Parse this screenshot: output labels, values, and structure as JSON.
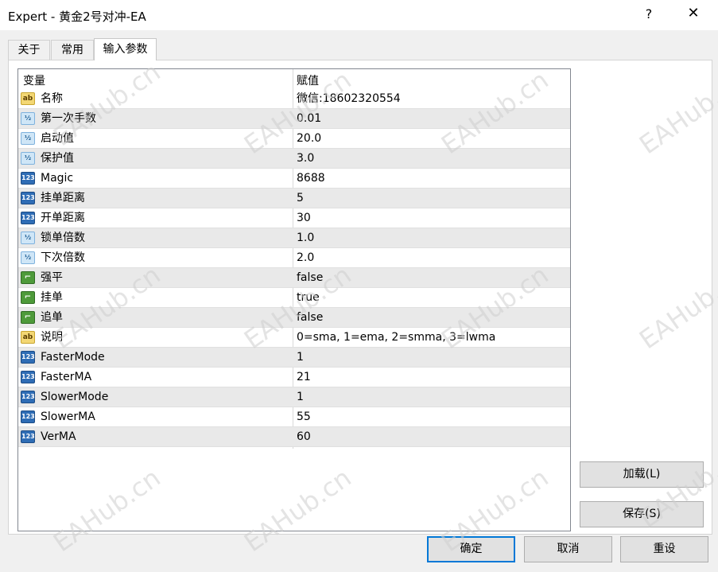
{
  "window": {
    "title": "Expert - 黄金2号对冲-EA",
    "help_label": "?",
    "close_label": "✕"
  },
  "tabs": [
    {
      "label": "关于"
    },
    {
      "label": "常用"
    },
    {
      "label": "输入参数"
    }
  ],
  "grid": {
    "headers": {
      "variable": "变量",
      "value": "赋值"
    },
    "rows": [
      {
        "icon": "ab",
        "name": "名称",
        "value": "微信:18602320554"
      },
      {
        "icon": "dec",
        "name": "第一次手数",
        "value": "0.01"
      },
      {
        "icon": "dec",
        "name": "启动值",
        "value": "20.0"
      },
      {
        "icon": "dec",
        "name": "保护值",
        "value": "3.0"
      },
      {
        "icon": "int",
        "name": "Magic",
        "value": "8688"
      },
      {
        "icon": "int",
        "name": "挂单距离",
        "value": "5"
      },
      {
        "icon": "int",
        "name": "开单距离",
        "value": "30"
      },
      {
        "icon": "dec",
        "name": "锁单倍数",
        "value": "1.0"
      },
      {
        "icon": "dec",
        "name": "下次倍数",
        "value": "2.0"
      },
      {
        "icon": "bool",
        "name": "强平",
        "value": "false"
      },
      {
        "icon": "bool",
        "name": "挂单",
        "value": "true"
      },
      {
        "icon": "bool",
        "name": "追单",
        "value": "false"
      },
      {
        "icon": "ab",
        "name": "说明",
        "value": "0=sma, 1=ema, 2=smma, 3=lwma"
      },
      {
        "icon": "int",
        "name": "FasterMode",
        "value": "1"
      },
      {
        "icon": "int",
        "name": "FasterMA",
        "value": "21"
      },
      {
        "icon": "int",
        "name": "SlowerMode",
        "value": "1"
      },
      {
        "icon": "int",
        "name": "SlowerMA",
        "value": "55"
      },
      {
        "icon": "int",
        "name": "VerMA",
        "value": "60"
      }
    ]
  },
  "icon_glyphs": {
    "ab": "ab",
    "dec": "½",
    "int": "123",
    "bool": "⌐"
  },
  "buttons": {
    "load": "加载(L)",
    "save": "保存(S)",
    "ok": "确定",
    "cancel": "取消",
    "reset": "重设"
  },
  "watermark": "EAHub.cn"
}
